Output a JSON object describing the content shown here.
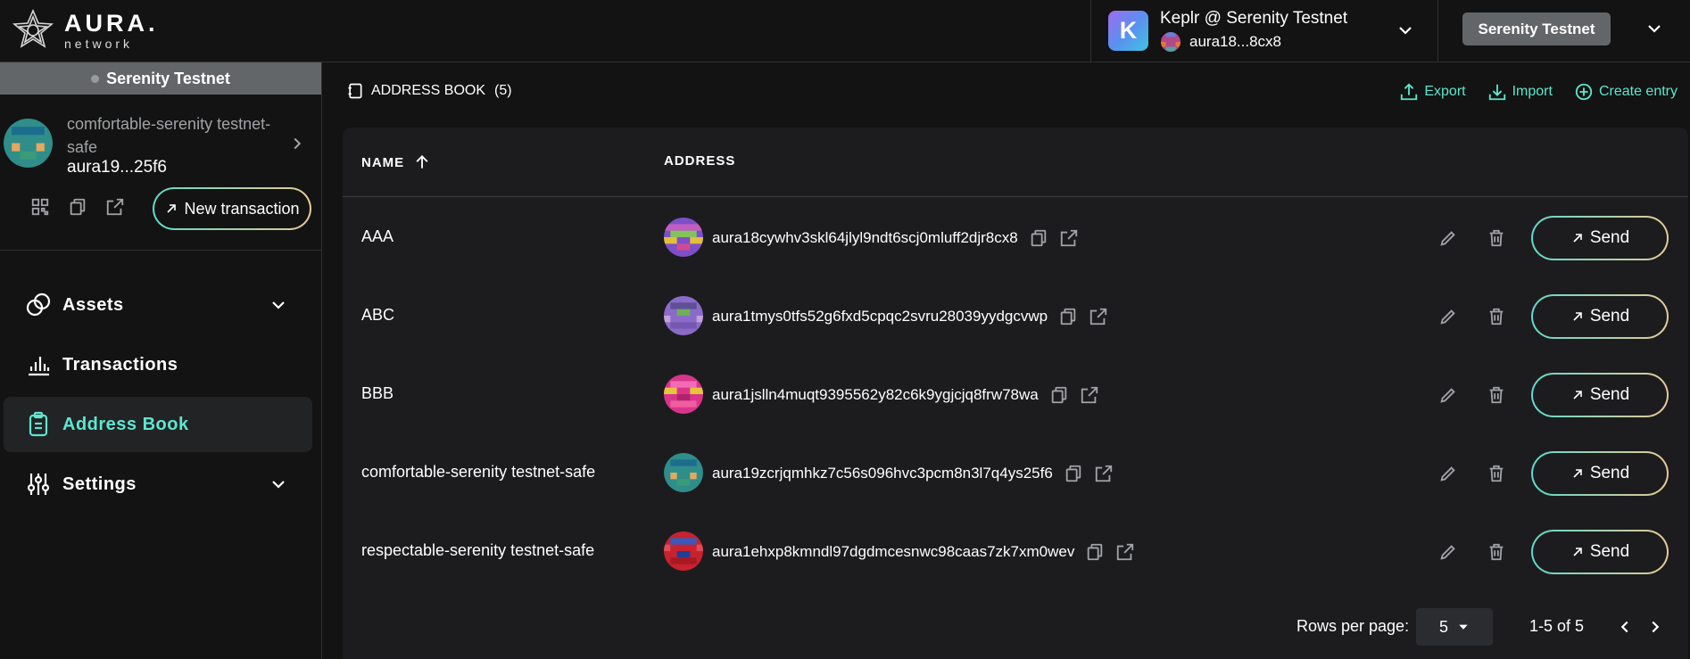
{
  "header": {
    "logo_big": "AURA.",
    "logo_small": "network",
    "wallet_letter": "K",
    "wallet_name": "Keplr @ Serenity Testnet",
    "wallet_address": "aura18...8cx8",
    "network_button": "Serenity Testnet"
  },
  "sidebar": {
    "network_label": "Serenity Testnet",
    "safe_name": "comfortable-serenity testnet-safe",
    "safe_address": "aura19...25f6",
    "new_transaction": "New transaction",
    "nav": [
      {
        "label": "Assets",
        "icon": "assets-icon"
      },
      {
        "label": "Transactions",
        "icon": "chart-bars-icon"
      },
      {
        "label": "Address Book",
        "icon": "clipboard-icon"
      },
      {
        "label": "Settings",
        "icon": "sliders-icon"
      }
    ],
    "active_color": "#5ee6d0"
  },
  "main": {
    "title": "ADDRESS BOOK",
    "count": "(5)",
    "actions": {
      "export": "Export",
      "import": "Import",
      "create": "Create entry"
    },
    "columns": {
      "name": "NAME",
      "address": "ADDRESS"
    },
    "rows": [
      {
        "name": "AAA",
        "address": "aura18cywhv3skl64jlyl9ndt6scj0mluff2djr8cx8",
        "send": "Send"
      },
      {
        "name": "ABC",
        "address": "aura1tmys0tfs52g6fxd5cpqc2svru28039yydgcvwp",
        "send": "Send"
      },
      {
        "name": "BBB",
        "address": "aura1jslln4muqt9395562y82c6k9ygjcjq8frw78wa",
        "send": "Send"
      },
      {
        "name": "comfortable-serenity testnet-safe",
        "address": "aura19zcrjqmhkz7c56s096hvc3pcm8n3l7q4ys25f6",
        "send": "Send"
      },
      {
        "name": "respectable-serenity testnet-safe",
        "address": "aura1ehxp8kmndl97dgdmcesnwc98caas7zk7xm0wev",
        "send": "Send"
      }
    ],
    "pager": {
      "label": "Rows per page:",
      "per_page": "5",
      "range": "1-5 of 5"
    }
  }
}
